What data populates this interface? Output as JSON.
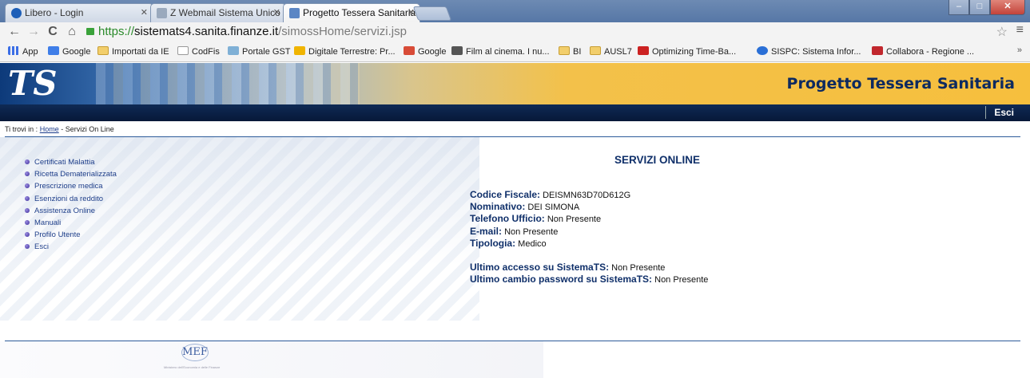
{
  "browser": {
    "tabs": [
      {
        "title": "Libero - Login",
        "active": false
      },
      {
        "title": "Z Webmail Sistema Unico P",
        "active": false
      },
      {
        "title": "Progetto Tessera Sanitaria",
        "active": true
      }
    ],
    "url": {
      "scheme": "https://",
      "host": "sistemats4.sanita.finanze.it",
      "path": "/simossHome/servizi.jsp"
    },
    "bookmarks": [
      {
        "label": "App",
        "icon": "apps"
      },
      {
        "label": "Google",
        "icon": "google"
      },
      {
        "label": "Importati da IE",
        "icon": "folder"
      },
      {
        "label": "CodFis",
        "icon": "doc"
      },
      {
        "label": "Portale GST",
        "icon": "gst"
      },
      {
        "label": "Digitale Terrestre: Pr...",
        "icon": "my"
      },
      {
        "label": "Google",
        "icon": "gplus"
      },
      {
        "label": "Film al cinema. I nu...",
        "icon": "film"
      },
      {
        "label": "BI",
        "icon": "folder"
      },
      {
        "label": "AUSL7",
        "icon": "folder"
      },
      {
        "label": "Optimizing Time-Ba...",
        "icon": "sql"
      },
      {
        "label": "SISPC: Sistema Infor...",
        "icon": "sispc"
      },
      {
        "label": "Collabora - Regione ...",
        "icon": "rt"
      }
    ],
    "bookmarks_more": "»"
  },
  "header": {
    "logo": "TS",
    "title": "Progetto Tessera Sanitaria",
    "logout": "Esci"
  },
  "breadcrumb": {
    "prefix": "Ti trovi in :",
    "home": "Home",
    "current": "- Servizi On Line"
  },
  "menu": [
    "Certificati Malattia",
    "Ricetta Dematerializzata",
    "Prescrizione medica",
    "Esenzioni da reddito",
    "Assistenza Online",
    "Manuali",
    "Profilo Utente",
    "Esci"
  ],
  "main": {
    "title": "SERVIZI ONLINE",
    "fields": {
      "codice_fiscale": {
        "label": "Codice Fiscale:",
        "value": "DEISMN63D70D612G"
      },
      "nominativo": {
        "label": "Nominativo:",
        "value": "DEI SIMONA"
      },
      "telefono": {
        "label": "Telefono Ufficio:",
        "value": "Non Presente"
      },
      "email": {
        "label": "E-mail:",
        "value": "Non Presente"
      },
      "tipologia": {
        "label": "Tipologia:",
        "value": "Medico"
      },
      "ultimo_accesso": {
        "label": "Ultimo accesso su SistemaTS:",
        "value": "Non Presente"
      },
      "ultimo_cambio": {
        "label": "Ultimo cambio password su SistemaTS:",
        "value": "Non Presente"
      }
    }
  },
  "footer": {
    "logo": "MEF",
    "subtitle": "Ministero dell'Economia e delle Finanze"
  }
}
